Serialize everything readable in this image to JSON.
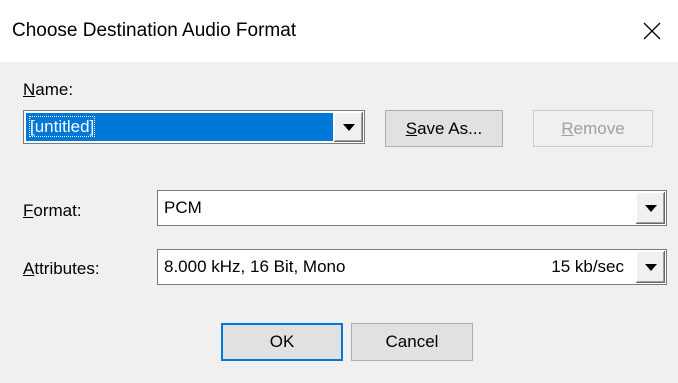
{
  "window": {
    "title": "Choose Destination Audio Format"
  },
  "name_field": {
    "label_mnemonic": "N",
    "label_rest": "ame:",
    "value": "[untitled]"
  },
  "buttons": {
    "save_as_mnemonic": "S",
    "save_as_rest": "ave As...",
    "remove_mnemonic": "R",
    "remove_rest": "emove",
    "ok": "OK",
    "cancel": "Cancel"
  },
  "format_field": {
    "label_mnemonic": "F",
    "label_rest": "ormat:",
    "value": "PCM"
  },
  "attributes_field": {
    "label_mnemonic": "A",
    "label_rest": "ttributes:",
    "value": "8.000 kHz, 16 Bit, Mono",
    "rate": "15 kb/sec"
  },
  "icons": {
    "close": "close-icon",
    "dropdown": "chevron-down-icon"
  },
  "colors": {
    "selection": "#0078d7",
    "default_button_border": "#0078d7",
    "disabled_text": "#a0a0a0"
  }
}
